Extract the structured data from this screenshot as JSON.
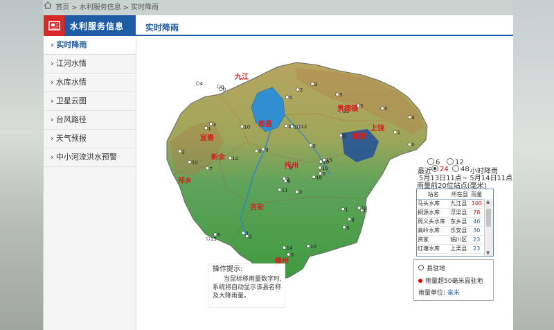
{
  "breadcrumb": {
    "home": "首页",
    "level1": "水利服务信息",
    "current": "实时降雨",
    "sep": ">"
  },
  "side": {
    "title": "水利服务信息"
  },
  "tab": {
    "label": "实时降雨"
  },
  "menu": [
    {
      "label": "实时降雨",
      "active": true
    },
    {
      "label": "江河水情"
    },
    {
      "label": "水库水情"
    },
    {
      "label": "卫星云图"
    },
    {
      "label": "台风路径"
    },
    {
      "label": "天气预报"
    },
    {
      "label": "中小河流洪水预警"
    }
  ],
  "map": {
    "region_labels": [
      "九江",
      "南昌",
      "景德镇",
      "上饶",
      "鹰潭",
      "宜春",
      "新余",
      "萍乡",
      "抚州",
      "吉安",
      "赣州"
    ],
    "station_values": [
      "3",
      "1",
      "0",
      "10",
      "2",
      "5",
      "12",
      "21",
      "18",
      "0",
      "7",
      "4",
      "11",
      "8",
      "10",
      "0",
      "6",
      "9",
      "10",
      "15",
      "0",
      "3",
      "5",
      "10",
      "1",
      "0",
      "2",
      "14",
      "0",
      "10",
      "5",
      "7",
      "10",
      "3",
      "0",
      "12",
      "0",
      "9",
      "2",
      "10",
      "6",
      "0",
      "13",
      "1",
      "8",
      "0",
      "4",
      "10",
      "0",
      "2"
    ]
  },
  "controls": {
    "opt6": "6",
    "opt12": "12",
    "recent": "最近",
    "opt24": "24",
    "opt48": "48",
    "hour_unit": "小时降雨",
    "time_range": "5月13日11点~ 5月14日11点",
    "top_title": "雨量前20位站点(毫米)"
  },
  "table": {
    "headers": [
      "站名",
      "所在县",
      "雨量"
    ],
    "rows": [
      {
        "station": "马头水库",
        "county": "九江县",
        "value": "100",
        "color": "red"
      },
      {
        "station": "桐源水库",
        "county": "浮梁县",
        "value": "78",
        "color": "red"
      },
      {
        "station": "周义头水库",
        "county": "东乡县",
        "value": "46",
        "color": "blue"
      },
      {
        "station": "高岭水库",
        "county": "乐安县",
        "value": "30",
        "color": "blue"
      },
      {
        "station": "资家",
        "county": "临川区",
        "value": "23",
        "color": "blue"
      },
      {
        "station": "红塘水库",
        "county": "上栗县",
        "value": "23",
        "color": "blue"
      }
    ]
  },
  "legend": {
    "station": "县驻地",
    "over50": "雨量超50毫米县驻地",
    "unit_label": "雨量单位:",
    "unit_value": "毫米"
  },
  "tips": {
    "title": "操作提示:",
    "body": "当鼠标移雨量数字时,系统将自动显示该县名称及大降雨量。"
  },
  "colors": {
    "brand": "#1e5ca6",
    "accent": "#d82929",
    "plain_green": "#3e9a3f",
    "mountain": "#b08a52"
  }
}
